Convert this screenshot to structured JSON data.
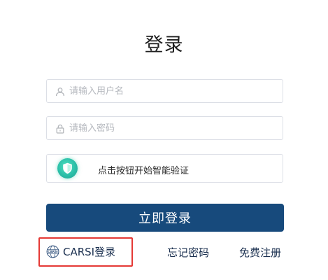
{
  "title": "登录",
  "username": {
    "placeholder": "请输入用户名",
    "value": "",
    "icon": "user-icon"
  },
  "password": {
    "placeholder": "请输入密码",
    "value": "",
    "icon": "lock-icon"
  },
  "captcha": {
    "label": "点击按钮开始智能验证",
    "icon": "shield-check-icon",
    "accent": "#2bbfa8"
  },
  "login_button": {
    "label": "立即登录",
    "color": "#174a7c"
  },
  "links": {
    "carsi": {
      "label": "CARSI登录",
      "icon": "carsi-globe-icon"
    },
    "forgot": "忘记密码",
    "register": "免费注册"
  },
  "highlight_color": "#e53935"
}
